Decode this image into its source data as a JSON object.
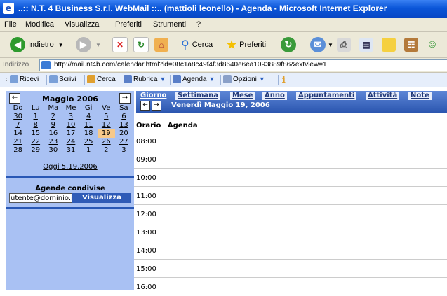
{
  "window": {
    "title": "..:: N.T. 4 Business S.r.l. WebMail ::.. (mattioli leonello) - Agenda - Microsoft Internet Explorer"
  },
  "menu": [
    "File",
    "Modifica",
    "Visualizza",
    "Preferiti",
    "Strumenti",
    "?"
  ],
  "toolbar": {
    "back": "Indietro",
    "search": "Cerca",
    "favorites": "Preferiti"
  },
  "address": {
    "label": "Indirizzo",
    "url": "http://mail.nt4b.com/calendar.html?id=08c1a8c49f4f3d8640e6ea1093889f86&extview=1"
  },
  "apptoolbar": {
    "items": [
      "Ricevi",
      "Scrivi",
      "Cerca",
      "Rubrica",
      "Agenda",
      "Opzioni"
    ]
  },
  "calendar": {
    "month": "Maggio 2006",
    "weekdays": [
      "Do",
      "Lu",
      "Ma",
      "Me",
      "Gi",
      "Ve",
      "Sa"
    ],
    "weeks": [
      [
        "30",
        "1",
        "2",
        "3",
        "4",
        "5",
        "6"
      ],
      [
        "7",
        "8",
        "9",
        "10",
        "11",
        "12",
        "13"
      ],
      [
        "14",
        "15",
        "16",
        "17",
        "18",
        "19",
        "20"
      ],
      [
        "21",
        "22",
        "23",
        "24",
        "25",
        "26",
        "27"
      ],
      [
        "28",
        "29",
        "30",
        "31",
        "1",
        "2",
        "3"
      ]
    ],
    "selected": "19",
    "today_link": "Oggi 5.19.2006"
  },
  "shared": {
    "title": "Agende condivise",
    "input_value": "utente@dominio.it",
    "button": "Visualizza"
  },
  "tabs": [
    "Giorno",
    "Settimana",
    "Mese",
    "Anno",
    "Appuntamenti",
    "Attività",
    "Note"
  ],
  "current_date": "Venerdì Maggio 19, 2006",
  "agenda": {
    "col_time": "Orario",
    "col_agenda": "Agenda",
    "hours": [
      "08:00",
      "09:00",
      "10:00",
      "11:00",
      "12:00",
      "13:00",
      "14:00",
      "15:00",
      "16:00"
    ]
  },
  "colors": {
    "titlebar": "#0a55d8",
    "sidebar": "#a9c1f3",
    "tabsbar": "#2b56b0",
    "selected_day": "#f7c98a"
  }
}
